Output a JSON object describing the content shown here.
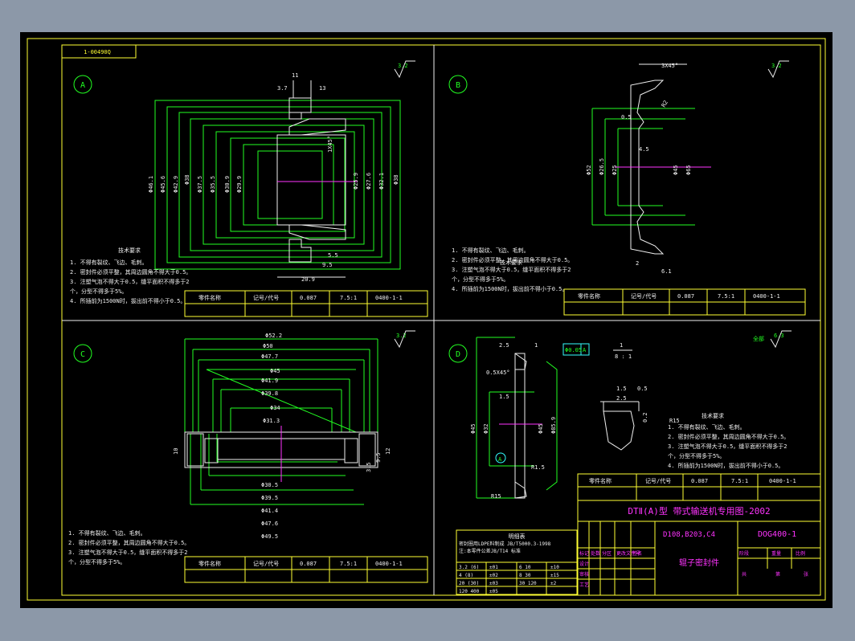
{
  "drawing_no_tag": "1-00490Q",
  "views": {
    "a": {
      "label": "A",
      "roughness": "3.2",
      "dims": {
        "d1": "11",
        "d2": "3.7",
        "d3": "13",
        "d4": "5.5",
        "d5": "9.5",
        "d6": "20.9",
        "d7": "Φ46.1",
        "d8": "Φ45.6",
        "d9": "Φ42.9",
        "d10": "Φ38",
        "d11": "Φ37.5",
        "d12": "Φ35.5",
        "d13": "Φ30.9",
        "d14": "Φ29.9",
        "d15": "Φ25.9",
        "d16": "Φ27.6",
        "d17": "Φ32.1",
        "d18": "Φ38",
        "d19": "1X45°"
      }
    },
    "b": {
      "label": "B",
      "roughness": "3.2",
      "dims": {
        "d1": "3X45°",
        "d2": "0.5",
        "d3": "R2",
        "d4": "4.5",
        "d5": "Φ52",
        "d6": "Φ26.5",
        "d7": "Φ25",
        "d8": "Φ45",
        "d9": "Φ65",
        "d10": "2",
        "d11": "6.1"
      }
    },
    "c": {
      "label": "C",
      "roughness": "3.2",
      "dims": {
        "d1": "Φ52.2",
        "d2": "Φ50",
        "d3": "Φ47.7",
        "d4": "Φ45",
        "d5": "Φ41.9",
        "d6": "Φ39.8",
        "d7": "Φ34",
        "d8": "Φ31.3",
        "d9": "Φ30.5",
        "d10": "Φ39.5",
        "d11": "Φ41.4",
        "d12": "Φ47.6",
        "d13": "Φ49.5",
        "d14": "10",
        "d15": "9.5",
        "d16": "12",
        "d17": "3.5"
      }
    },
    "d": {
      "label": "D",
      "roughness": "6.3",
      "scale_top": "1",
      "scale_bot": "8 : 1",
      "all_label": "全部",
      "tol_frame": "Φ0.05",
      "tol_ref": "A",
      "datum": "A",
      "dims": {
        "d1": "2.5",
        "d2": "1",
        "d3": "0.5X45°",
        "d4": "1.5",
        "d5": "R15",
        "d6": "Φ45",
        "d7": "Φ32",
        "d8": "Φ45",
        "d9": "Φ85.9",
        "d10": "R1.5",
        "d11": "R15",
        "d12": "2.5",
        "d13": "1.5",
        "d14": "0.5",
        "d15": "0.2"
      }
    }
  },
  "notes": {
    "title": "技术要求",
    "lines": [
      "1. 不得有裂纹、飞边、毛刺。",
      "2. 密封件必须平整，其周边圆角不得大于0.5。",
      "3. 注塑气泡不得大于0.5，缝平面积不得多于2",
      "个，分型不得多于5%。",
      "4. 所插前为1500N时，拔出前不得小于0.5。"
    ]
  },
  "small_table": {
    "c1": "零件名称",
    "c2": "记号/代号",
    "c3": "0.087",
    "c4": "7.5:1",
    "c5": "0400-1-1",
    "sign": "签"
  },
  "parts_table": {
    "title": "明细表",
    "row1": "密封圈用LDPE料制成 JB/T5000.3-1998",
    "row2": "注:本零件公差JB/T14 标准",
    "rows": [
      [
        "3.2 (6)",
        "±01",
        "6 10",
        "±10"
      ],
      [
        "4 (8)",
        "±02",
        "8 30",
        "±15"
      ],
      [
        "20 (30)",
        "±03",
        "30 120",
        "±2"
      ],
      [
        "120 400",
        "±05",
        "",
        ""
      ]
    ]
  },
  "title_block": {
    "main_title": "DTⅡ(A)型 带式输送机专用图-2002",
    "code_left": "D108,B203,C4",
    "code_right": "DOG400-1",
    "part_name": "辊子密封件",
    "sign1": "标记",
    "sign2": "处数",
    "sign3": "分区",
    "sign4": "更改文件号",
    "sign5": "签名",
    "s_std": "标准化",
    "s_grade": "阶段",
    "s_weight": "重量",
    "s_scale": "比例",
    "s_design": "设计",
    "s_check": "审核",
    "s_craft": "工艺",
    "s_sheet": "共",
    "s_page": "第",
    "s_page2": "张"
  }
}
